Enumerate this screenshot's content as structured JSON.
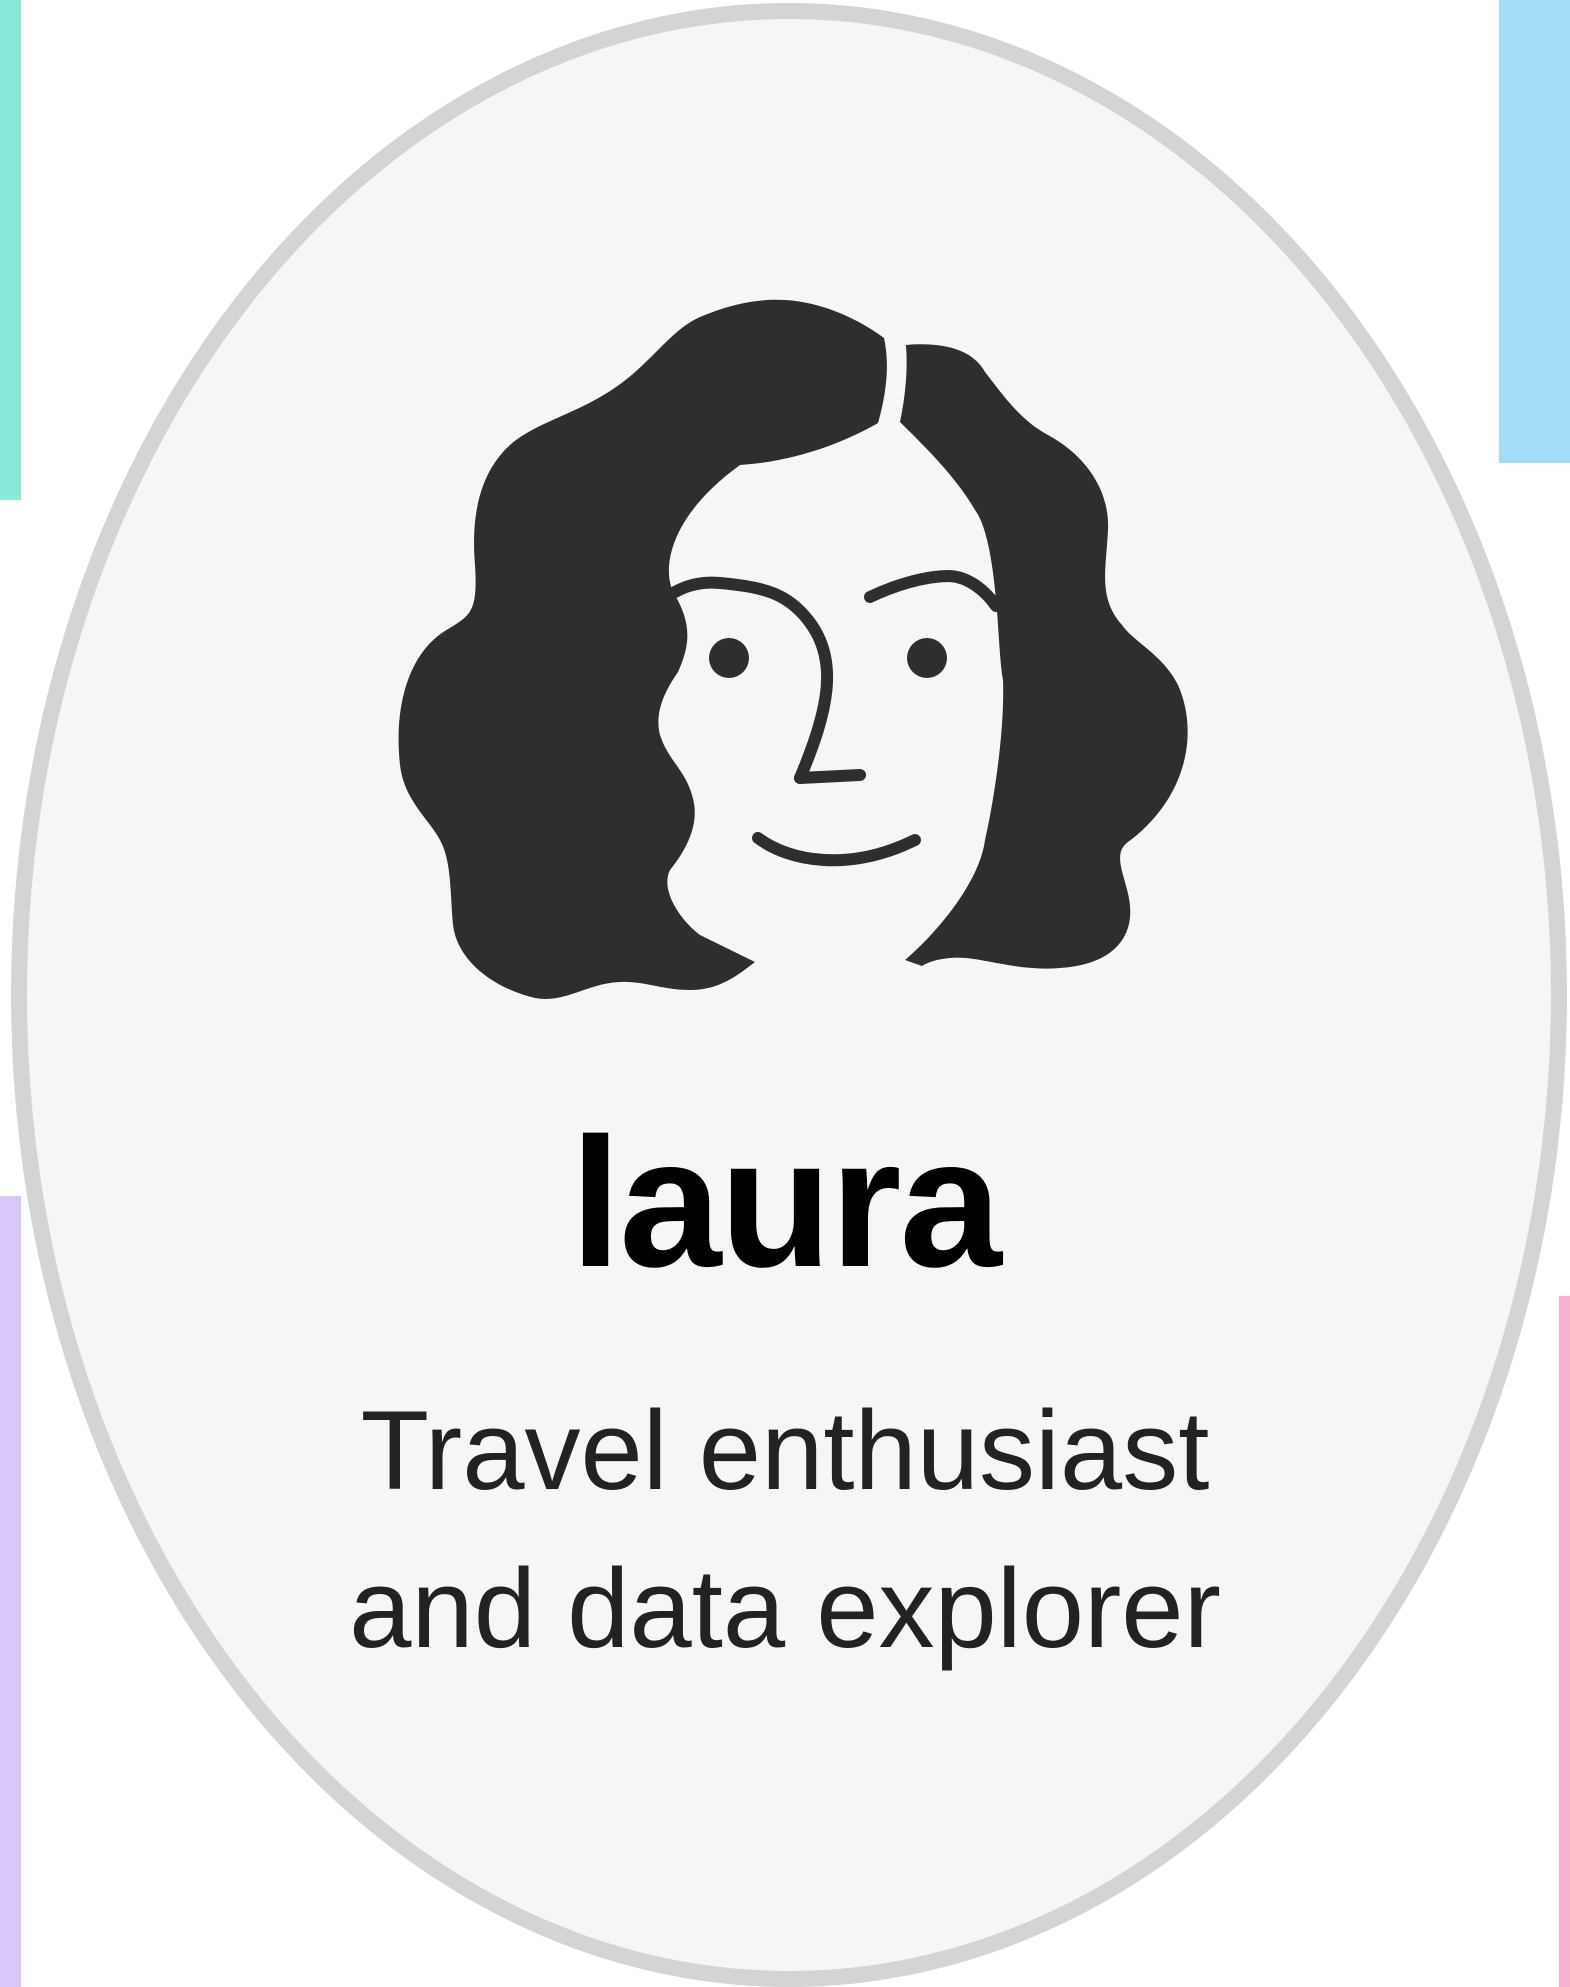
{
  "profile": {
    "name": "laura",
    "bio": "Travel enthusiast and data explorer",
    "avatar_icon": "woman-portrait-icon"
  },
  "colors": {
    "card_fill": "#f6f6f6",
    "card_border": "#d4d4d4",
    "hair": "#2e2e2e",
    "name_text": "#000000",
    "bio_text": "#222222",
    "accent_teal": "#88e8da",
    "accent_blue": "#a2dcf7",
    "accent_lavender": "#d8c8fa",
    "accent_pink": "#f7b2cf"
  }
}
